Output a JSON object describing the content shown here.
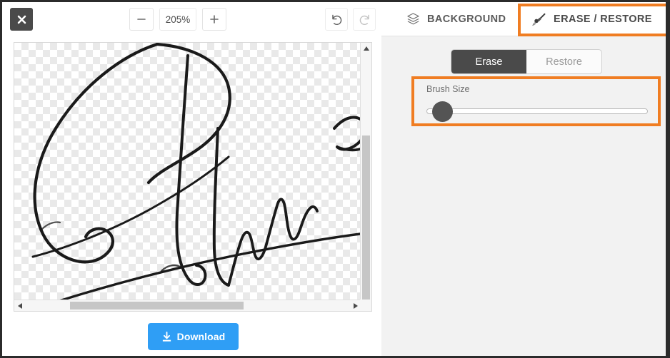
{
  "toolbar": {
    "close_icon": "close-icon",
    "zoom_out_label": "−",
    "zoom_level": "205%",
    "zoom_in_label": "+",
    "undo_icon": "undo-icon",
    "redo_icon": "redo-icon"
  },
  "canvas": {
    "background_type": "transparent-checkerboard",
    "content": "handwritten-signature",
    "vscroll_up_icon": "▲",
    "vscroll_down_icon": "▼",
    "hscroll_left_icon": "◀",
    "hscroll_right_icon": "▶"
  },
  "download": {
    "label": "Download",
    "icon": "download-icon",
    "color": "#2f9ef5"
  },
  "panel": {
    "tabs": [
      {
        "label": "BACKGROUND",
        "icon": "layers-icon",
        "active": false
      },
      {
        "label": "ERASE / RESTORE",
        "icon": "brush-icon",
        "active": true
      }
    ],
    "highlight_color": "#f07d22",
    "mode_toggle": {
      "options": [
        {
          "label": "Erase",
          "selected": true
        },
        {
          "label": "Restore",
          "selected": false
        }
      ]
    },
    "brush": {
      "label": "Brush Size",
      "value_percent": 3,
      "min": 0,
      "max": 100
    }
  }
}
